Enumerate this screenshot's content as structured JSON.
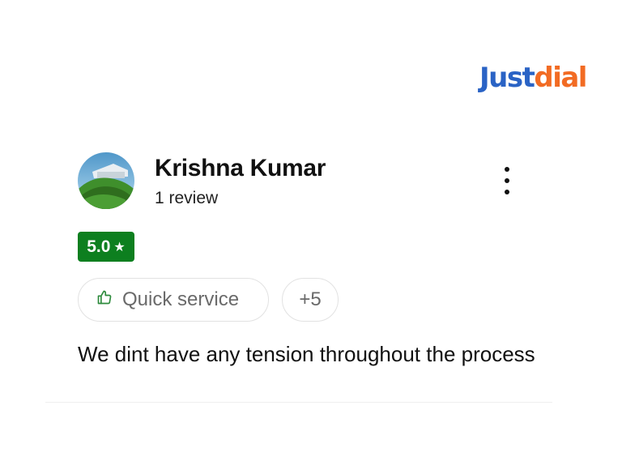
{
  "brand": {
    "logo_part1": "Just",
    "logo_part2": "dial"
  },
  "review": {
    "reviewer_name": "Krishna Kumar",
    "review_count": "1 review",
    "rating": "5.0",
    "rating_icon": "star-icon",
    "tags": [
      {
        "label": "Quick service",
        "icon": "thumbs-up-icon"
      }
    ],
    "more_tags": "+5",
    "text": "We dint have any tension throughout the process"
  },
  "colors": {
    "rating_badge": "#0d7f1f",
    "logo_blue": "#2a63c5",
    "logo_orange": "#f26b23",
    "tag_icon": "#2e8b3d"
  }
}
